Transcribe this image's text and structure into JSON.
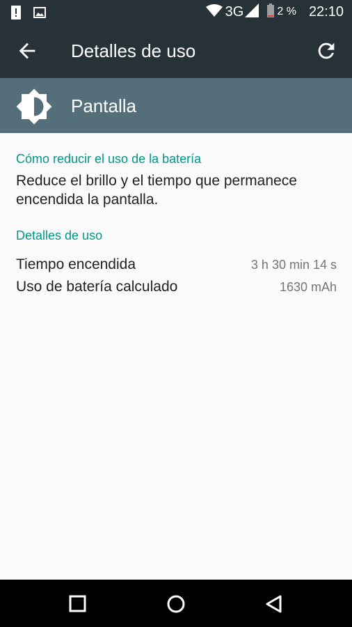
{
  "status_bar": {
    "network": "3G",
    "battery_percent": "2 %",
    "time": "22:10",
    "icons": [
      "alert-icon",
      "image-icon",
      "wifi-icon",
      "signal-icon",
      "battery-icon"
    ]
  },
  "toolbar": {
    "title": "Detalles de uso",
    "back_icon": "arrow-left-icon",
    "refresh_icon": "refresh-icon"
  },
  "header": {
    "icon": "brightness-icon",
    "title": "Pantalla"
  },
  "tips": {
    "title": "Cómo reducir el uso de la batería",
    "text": "Reduce el brillo y el tiempo que permanece encendida la pantalla."
  },
  "usage": {
    "title": "Detalles de uso",
    "rows": [
      {
        "label": "Tiempo encendida",
        "value": "3 h 30 min 14 s"
      },
      {
        "label": "Uso de batería calculado",
        "value": "1630 mAh"
      }
    ]
  },
  "navbar": {
    "icons": [
      "recents-icon",
      "home-icon",
      "back-triangle-icon"
    ]
  },
  "colors": {
    "toolbar_bg": "#263238",
    "header_bg": "#546e7a",
    "accent": "#009688",
    "background": "#fafafa"
  }
}
